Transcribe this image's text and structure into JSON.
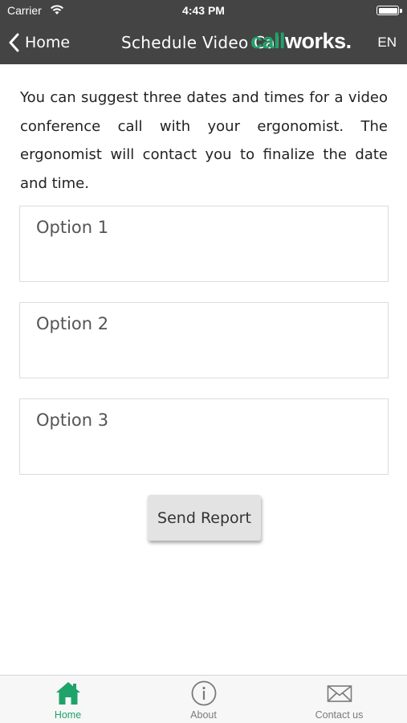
{
  "status_bar": {
    "carrier": "Carrier",
    "time": "4:43 PM"
  },
  "nav": {
    "back_label": "Home",
    "title": "Schedule Video Call",
    "brand_part_a": "call",
    "brand_part_b": "works.",
    "language": "EN"
  },
  "intro": "You can suggest three dates and times for a video conference call with your ergonomist. The ergonomist will contact you to finalize the date and time.",
  "options": [
    {
      "placeholder": "Option 1",
      "value": ""
    },
    {
      "placeholder": "Option 2",
      "value": ""
    },
    {
      "placeholder": "Option 3",
      "value": ""
    }
  ],
  "send_button_label": "Send Report",
  "tabs": [
    {
      "label": "Home",
      "icon": "home-icon",
      "active": true
    },
    {
      "label": "About",
      "icon": "info-icon",
      "active": false
    },
    {
      "label": "Contact us",
      "icon": "envelope-icon",
      "active": false
    }
  ],
  "colors": {
    "bar_background": "#444444",
    "brand_green": "#1ea36b",
    "tab_inactive": "#7a7a7a"
  }
}
